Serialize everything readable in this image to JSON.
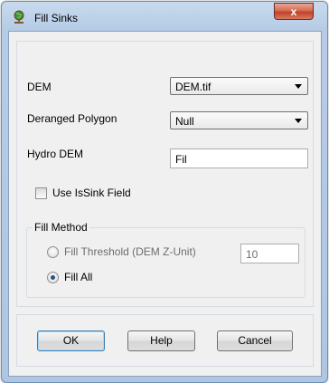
{
  "window": {
    "title": "Fill Sinks",
    "app_icon": "globe-stand-icon",
    "close_glyph": "x"
  },
  "form": {
    "dem": {
      "label": "DEM",
      "value": "DEM.tif"
    },
    "deranged_polygon": {
      "label": "Deranged Polygon",
      "value": "Null"
    },
    "hydro_dem": {
      "label": "Hydro DEM",
      "value": "Fil"
    },
    "use_issink": {
      "label": "Use IsSink Field",
      "checked": false
    }
  },
  "fill_method": {
    "title": "Fill Method",
    "threshold": {
      "label": "Fill Threshold (DEM Z-Unit)",
      "value": "10",
      "selected": false,
      "enabled": false
    },
    "fill_all": {
      "label": "Fill All",
      "selected": true
    }
  },
  "buttons": {
    "ok": "OK",
    "help": "Help",
    "cancel": "Cancel"
  },
  "colors": {
    "title_bar": "#b9cfe8",
    "close_button": "#c9553a",
    "panel_bg": "#f0f0f0",
    "radio_dot": "#2a4f8e"
  }
}
